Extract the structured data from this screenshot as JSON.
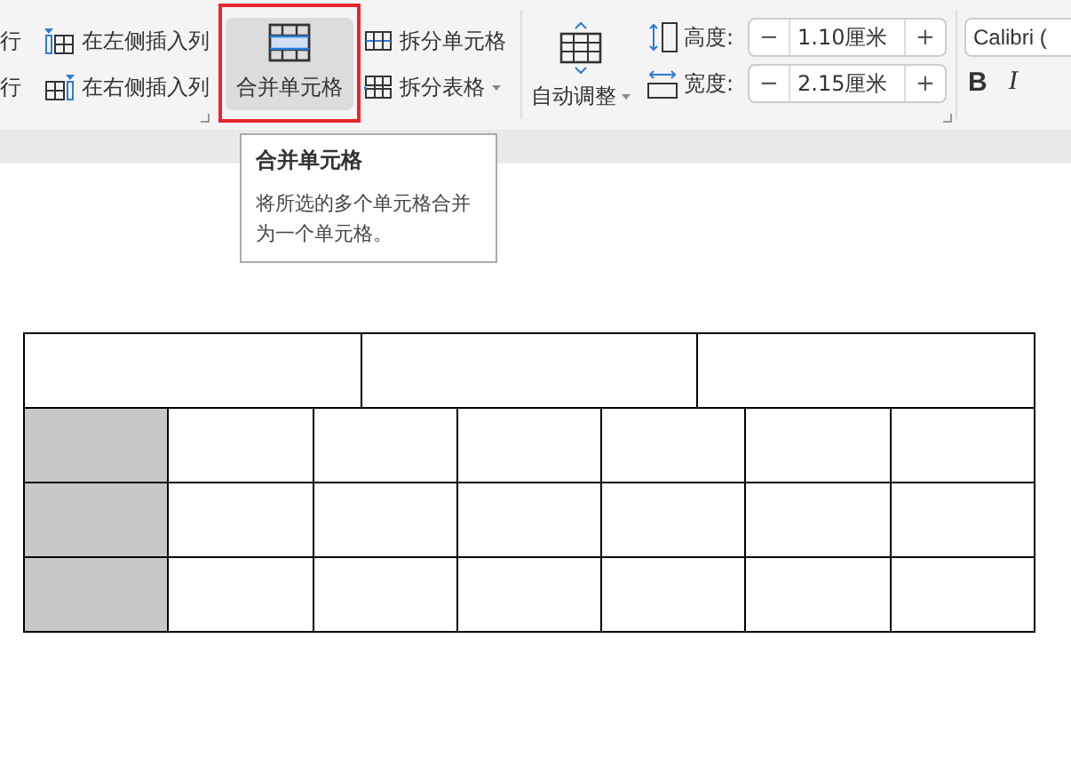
{
  "ribbon": {
    "insert_group": {
      "rows": [
        {
          "cut_label": "行",
          "button": "在左侧插入列",
          "kind": "left"
        },
        {
          "cut_label": "行",
          "button": "在右侧插入列",
          "kind": "right"
        }
      ]
    },
    "merge_button": {
      "label": "合并单元格",
      "highlighted": true
    },
    "split_buttons": [
      {
        "label": "拆分单元格",
        "dropdown": false
      },
      {
        "label": "拆分表格",
        "dropdown": true
      }
    ],
    "auto_fit": {
      "label": "自动调整"
    },
    "size_fields": [
      {
        "kind": "height",
        "label": "高度:",
        "minus": "−",
        "value": "1.10厘米",
        "plus": "+"
      },
      {
        "kind": "width",
        "label": "宽度:",
        "minus": "−",
        "value": "2.15厘米",
        "plus": "+"
      }
    ],
    "font": {
      "name": "Calibri (",
      "bold": "B",
      "italic": "I"
    }
  },
  "tooltip": {
    "title": "合并单元格",
    "description": "将所选的多个单元格合并为一个单元格。"
  },
  "table": {
    "rows": [
      {
        "cells": [
          {
            "selected": false
          },
          {
            "selected": false
          },
          {
            "selected": false
          }
        ]
      },
      {
        "cells": [
          {
            "selected": true
          },
          {
            "selected": false
          },
          {
            "selected": false
          },
          {
            "selected": false
          },
          {
            "selected": false
          },
          {
            "selected": false
          },
          {
            "selected": false
          }
        ]
      },
      {
        "cells": [
          {
            "selected": true
          },
          {
            "selected": false
          },
          {
            "selected": false
          },
          {
            "selected": false
          },
          {
            "selected": false
          },
          {
            "selected": false
          },
          {
            "selected": false
          }
        ]
      },
      {
        "cells": [
          {
            "selected": true
          },
          {
            "selected": false
          },
          {
            "selected": false
          },
          {
            "selected": false
          },
          {
            "selected": false
          },
          {
            "selected": false
          },
          {
            "selected": false
          }
        ]
      }
    ]
  }
}
